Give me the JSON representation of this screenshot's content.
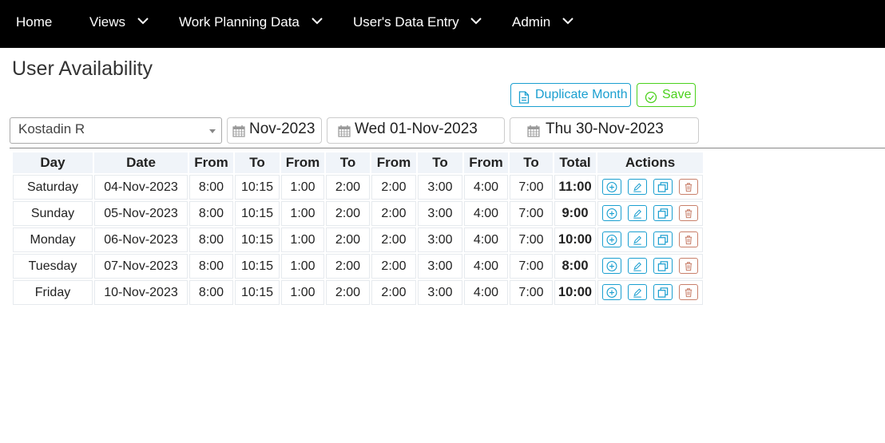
{
  "nav": {
    "items": [
      {
        "label": "Home",
        "dropdown": false
      },
      {
        "label": "Views",
        "dropdown": true
      },
      {
        "label": "Work Planning Data",
        "dropdown": true
      },
      {
        "label": "User's Data Entry",
        "dropdown": true
      },
      {
        "label": "Admin",
        "dropdown": true
      }
    ]
  },
  "page": {
    "title": "User Availability"
  },
  "toolbar": {
    "duplicate_label": "Duplicate Month",
    "save_label": "Save"
  },
  "filters": {
    "user": "Kostadin R",
    "month": "Nov-2023",
    "start_date": "Wed 01-Nov-2023",
    "end_date": "Thu 30-Nov-2023"
  },
  "table": {
    "headers": [
      "Day",
      "Date",
      "From",
      "To",
      "From",
      "To",
      "From",
      "To",
      "From",
      "To",
      "Total",
      "Actions"
    ],
    "rows": [
      {
        "day": "Saturday",
        "date": "04-Nov-2023",
        "times": [
          "8:00",
          "10:15",
          "1:00",
          "2:00",
          "2:00",
          "3:00",
          "4:00",
          "7:00"
        ],
        "total": "11:00"
      },
      {
        "day": "Sunday",
        "date": "05-Nov-2023",
        "times": [
          "8:00",
          "10:15",
          "1:00",
          "2:00",
          "2:00",
          "3:00",
          "4:00",
          "7:00"
        ],
        "total": "9:00"
      },
      {
        "day": "Monday",
        "date": "06-Nov-2023",
        "times": [
          "8:00",
          "10:15",
          "1:00",
          "2:00",
          "2:00",
          "3:00",
          "4:00",
          "7:00"
        ],
        "total": "10:00"
      },
      {
        "day": "Tuesday",
        "date": "07-Nov-2023",
        "times": [
          "8:00",
          "10:15",
          "1:00",
          "2:00",
          "2:00",
          "3:00",
          "4:00",
          "7:00"
        ],
        "total": "8:00"
      },
      {
        "day": "Friday",
        "date": "10-Nov-2023",
        "times": [
          "8:00",
          "10:15",
          "1:00",
          "2:00",
          "2:00",
          "3:00",
          "4:00",
          "7:00"
        ],
        "total": "10:00"
      }
    ]
  },
  "colors": {
    "nav_bg": "#000000",
    "accent_blue": "#1a9fd0",
    "save_green": "#4bd11c",
    "delete_red": "#c87f6a",
    "header_bg": "#f0f4f9"
  },
  "icons": {
    "nav_dropdown": "chevron-down-icon",
    "duplicate": "document-icon",
    "save": "check-circle-icon",
    "date": "calendar-icon",
    "row_actions": [
      "add-circle-icon",
      "edit-pencil-icon",
      "copy-icon",
      "trash-icon"
    ]
  }
}
